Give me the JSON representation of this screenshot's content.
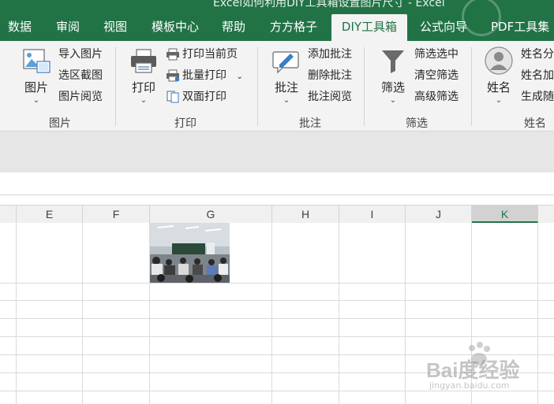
{
  "window": {
    "title": "Excel如何利用DIY工具箱设置图片尺寸 - Excel"
  },
  "tabs": [
    {
      "label": "数据"
    },
    {
      "label": "审阅"
    },
    {
      "label": "视图"
    },
    {
      "label": "模板中心"
    },
    {
      "label": "帮助"
    },
    {
      "label": "方方格子"
    },
    {
      "label": "DIY工具箱"
    },
    {
      "label": "公式向导"
    },
    {
      "label": "PDF工具集"
    }
  ],
  "ribbon": {
    "picture_group": {
      "label": "图片",
      "main_button": "图片",
      "items": [
        "导入图片",
        "选区截图",
        "图片阅览"
      ]
    },
    "print_group": {
      "label": "打印",
      "main_button": "打印",
      "items": [
        "打印当前页",
        "批量打印",
        "双面打印"
      ]
    },
    "comment_group": {
      "label": "批注",
      "main_button": "批注",
      "items": [
        "添加批注",
        "删除批注",
        "批注阅览"
      ]
    },
    "filter_group": {
      "label": "筛选",
      "main_button": "筛选",
      "items": [
        "筛选选中",
        "清空筛选",
        "高级筛选"
      ]
    },
    "name_group": {
      "label": "姓名",
      "main_button": "姓名",
      "items": [
        "姓名分",
        "姓名加",
        "生成随"
      ]
    }
  },
  "sheet": {
    "columns": [
      "E",
      "F",
      "G",
      "H",
      "I",
      "J",
      "K"
    ],
    "selected_column": "K"
  },
  "watermark": {
    "main": "Bai度经验",
    "sub": "jingyan.baidu.com"
  },
  "colors": {
    "excel_green": "#217346",
    "ribbon_bg": "#f3f3f3"
  },
  "icons": [
    "picture-icon",
    "printer-icon",
    "print-page-icon",
    "batch-print-icon",
    "duplex-print-icon",
    "pencil-comment-icon",
    "funnel-icon",
    "person-icon",
    "chevron-down-icon"
  ]
}
